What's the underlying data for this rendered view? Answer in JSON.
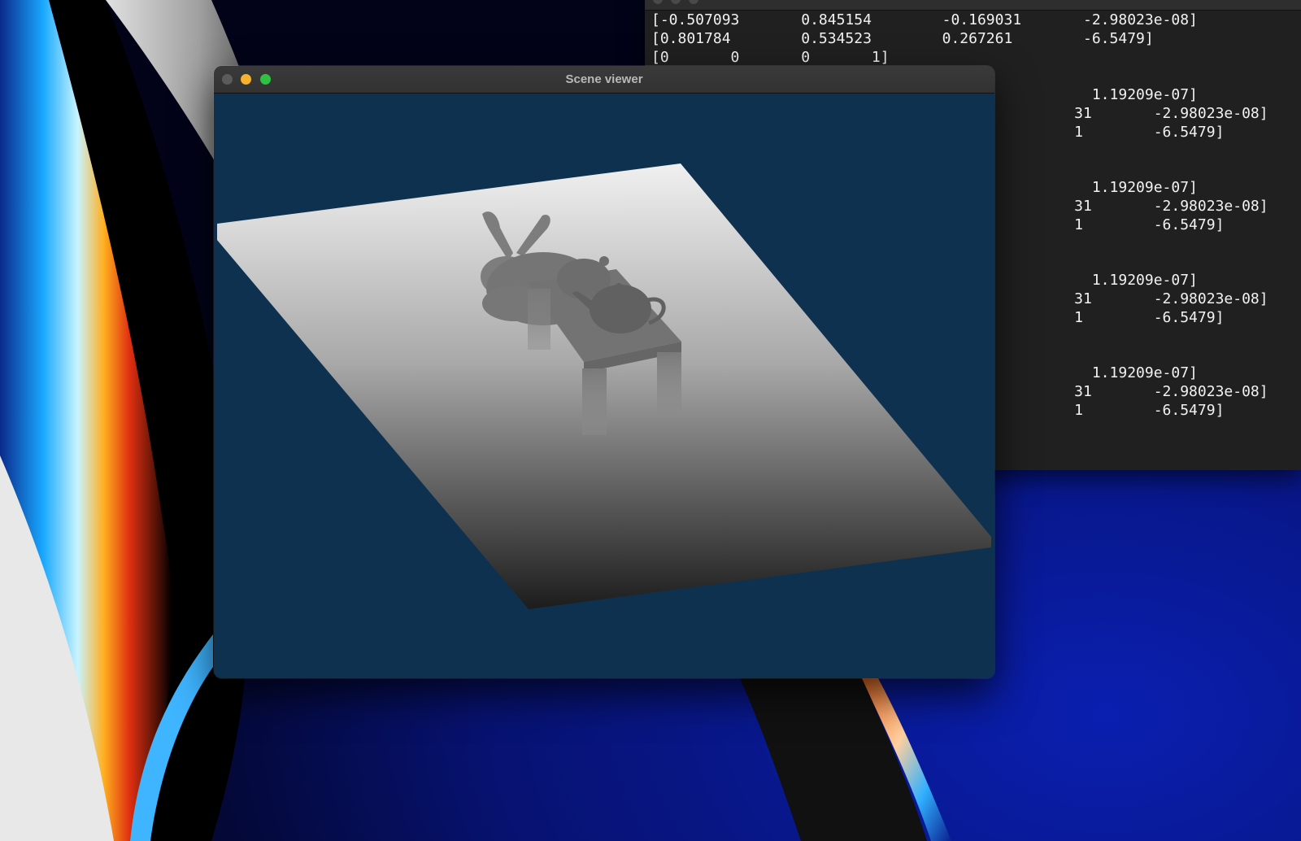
{
  "scene_window": {
    "title": "Scene viewer",
    "viewport_background": "#0f3150"
  },
  "terminal": {
    "lines": [
      "[-0.507093       0.845154        -0.169031       -2.98023e-08]",
      "[0.801784        0.534523        0.267261        -6.5479]",
      "[0       0       0       1]",
      "                                                  1.19209e-07]",
      "                                                31       -2.98023e-08]",
      "                                                1        -6.5479]",
      "                                                  1.19209e-07]",
      "                                                31       -2.98023e-08]",
      "                                                1        -6.5479]",
      "                                                  1.19209e-07]",
      "                                                31       -2.98023e-08]",
      "                                                1        -6.5479]",
      "                                                  1.19209e-07]",
      "                                                31       -2.98023e-08]",
      "                                                1        -6.5479]"
    ]
  },
  "colors": {
    "desktop_blue": "#0a1f8f",
    "traffic_close": "#5b5b5b",
    "traffic_minimize": "#f6b12e",
    "traffic_zoom": "#2fc242"
  }
}
